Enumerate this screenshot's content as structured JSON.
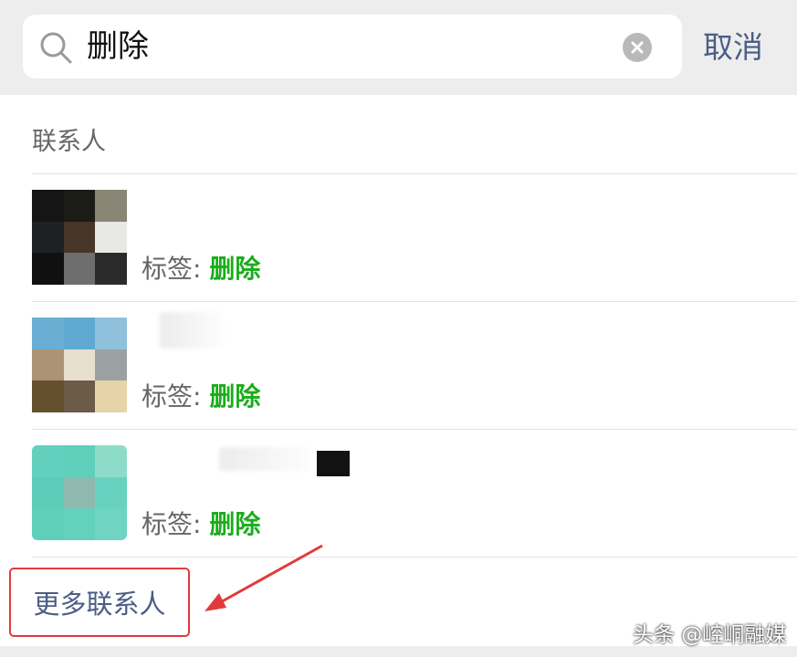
{
  "search": {
    "value": "删除",
    "cancel_label": "取消"
  },
  "results": {
    "section_title": "联系人",
    "contacts": [
      {
        "tag_label": "标签: ",
        "tag_value": "删除"
      },
      {
        "tag_label": "标签: ",
        "tag_value": "删除"
      },
      {
        "tag_label": "标签: ",
        "tag_value": "删除"
      }
    ],
    "more_label": "更多联系人"
  },
  "watermark": "头条 @崆峒融媒",
  "colors": {
    "accent_green": "#1aad19",
    "link_blue": "#4b5d86",
    "highlight_red": "#e23a3a"
  },
  "icons": [
    "search-icon",
    "clear-icon",
    "arrow-annotation"
  ]
}
